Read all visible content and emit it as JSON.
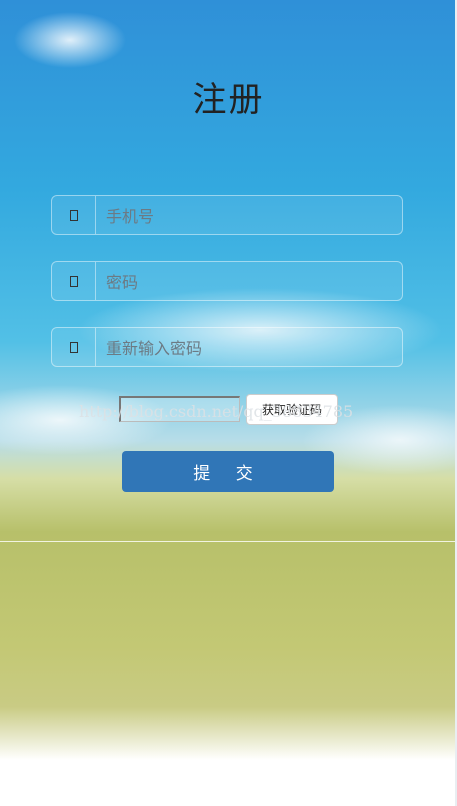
{
  "page": {
    "title": "注册"
  },
  "form": {
    "fields": [
      {
        "name": "phone",
        "placeholder": "手机号",
        "icon": "phone-icon"
      },
      {
        "name": "password",
        "placeholder": "密码",
        "icon": "lock-icon"
      },
      {
        "name": "confirm",
        "placeholder": "重新输入密码",
        "icon": "lock-icon"
      }
    ],
    "verify_code": {
      "value": "",
      "button_label": "获取验证码"
    },
    "submit_label": "提 交"
  },
  "watermark": "http://blog.csdn.net/qq_38834785",
  "colors": {
    "submit_bg": "#3076b7",
    "title": "#222222"
  }
}
